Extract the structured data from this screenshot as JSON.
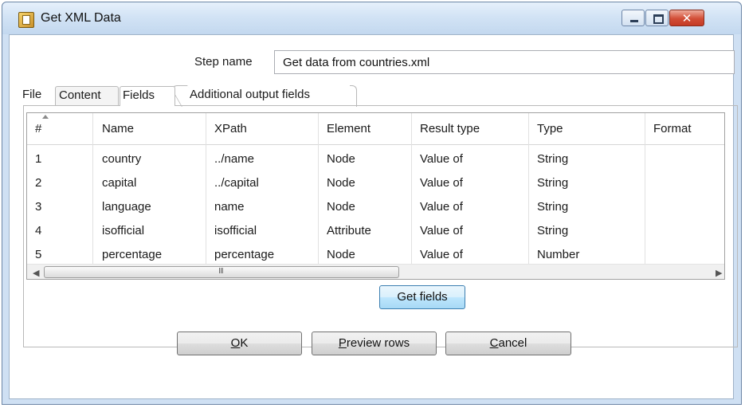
{
  "window": {
    "title": "Get XML Data"
  },
  "step": {
    "label": "Step name",
    "value": "Get data from countries.xml"
  },
  "tabs": [
    "File",
    "Content",
    "Fields",
    "Additional output fields"
  ],
  "table": {
    "columns": [
      "#",
      "Name",
      "XPath",
      "Element",
      "Result type",
      "Type",
      "Format"
    ],
    "rows": [
      [
        "1",
        "country",
        "../name",
        "Node",
        "Value of",
        "String",
        ""
      ],
      [
        "2",
        "capital",
        "../capital",
        "Node",
        "Value of",
        "String",
        ""
      ],
      [
        "3",
        "language",
        "name",
        "Node",
        "Value of",
        "String",
        ""
      ],
      [
        "4",
        "isofficial",
        "isofficial",
        "Attribute",
        "Value of",
        "String",
        ""
      ],
      [
        "5",
        "percentage",
        "percentage",
        "Node",
        "Value of",
        "Number",
        ""
      ]
    ],
    "scroll_grip": "III"
  },
  "buttons": {
    "get_fields": "Get fields",
    "ok_mnemonic": "O",
    "ok_rest": "K",
    "preview_mnemonic": "P",
    "preview_rest": "review rows",
    "cancel_mnemonic": "C",
    "cancel_rest": "ancel"
  }
}
